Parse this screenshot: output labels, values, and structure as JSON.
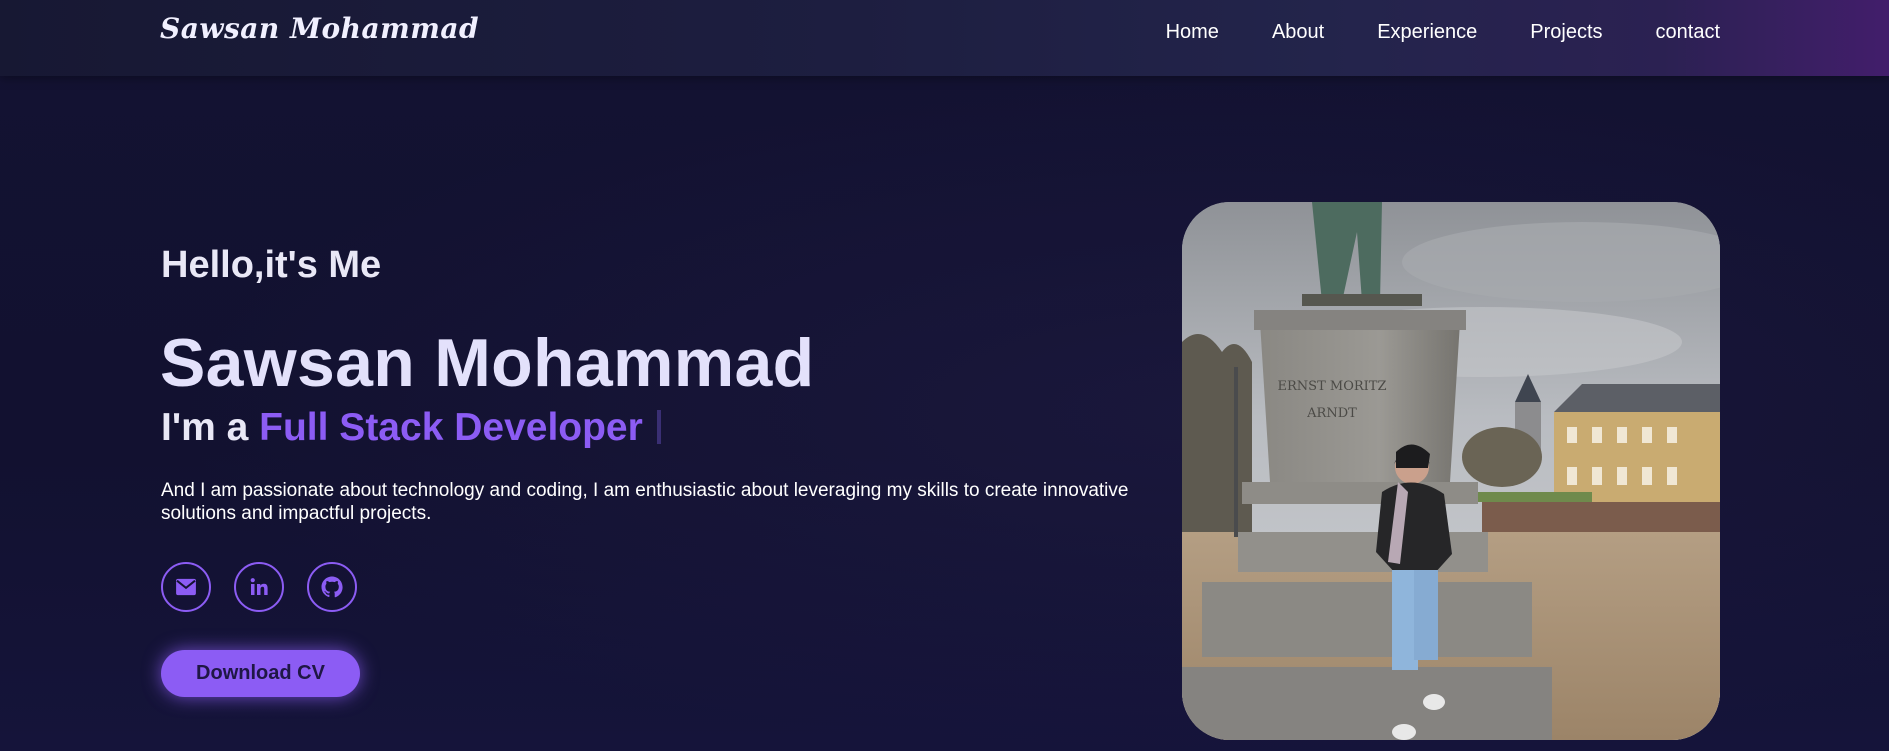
{
  "header": {
    "logo": "Sawsan Mohammad",
    "nav": [
      "Home",
      "About",
      "Experience",
      "Projects",
      "contact"
    ]
  },
  "hero": {
    "greeting": "Hello,it's Me",
    "name": "Sawsan Mohammad",
    "role_prefix": "I'm a ",
    "role_highlight": "Full Stack Developer",
    "description": "And I am passionate about technology and coding, I am enthusiastic about leveraging my skills to create innovative solutions and impactful projects.",
    "socials": [
      {
        "icon": "mail-icon"
      },
      {
        "icon": "linkedin-icon"
      },
      {
        "icon": "github-icon"
      }
    ],
    "cv_button": "Download CV",
    "photo_inscription": [
      "ERNST MORITZ",
      "ARNDT"
    ]
  },
  "colors": {
    "accent": "#8c5cf4",
    "background": "#141331",
    "header_gradient_end": "#421e6b"
  }
}
